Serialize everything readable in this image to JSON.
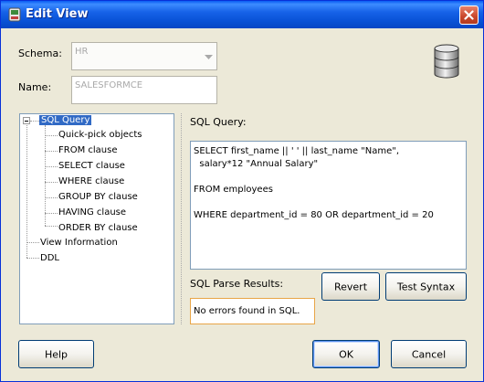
{
  "window": {
    "title": "Edit View"
  },
  "form": {
    "schema_label": "Schema:",
    "schema_value": "HR",
    "name_label": "Name:",
    "name_value": "SALESFORMCE"
  },
  "tree": {
    "root": "SQL Query",
    "children": [
      "Quick-pick objects",
      "FROM clause",
      "SELECT clause",
      "WHERE clause",
      "GROUP BY clause",
      "HAVING clause",
      "ORDER BY clause"
    ],
    "other": [
      "View Information",
      "DDL"
    ]
  },
  "sql": {
    "label": "SQL Query:",
    "lines": [
      "SELECT first_name || ' ' || last_name \"Name\",",
      "  salary*12 \"Annual Salary\"",
      "",
      "FROM employees",
      "",
      "WHERE department_id = 80 OR department_id = 20"
    ],
    "parse_label": "SQL Parse Results:",
    "parse_result": "No errors found in SQL."
  },
  "buttons": {
    "revert": "Revert",
    "test_syntax": "Test Syntax",
    "help": "Help",
    "ok": "OK",
    "cancel": "Cancel"
  },
  "icons": {
    "title_icon": "app-icon",
    "close": "close-icon",
    "database": "database-icon"
  }
}
